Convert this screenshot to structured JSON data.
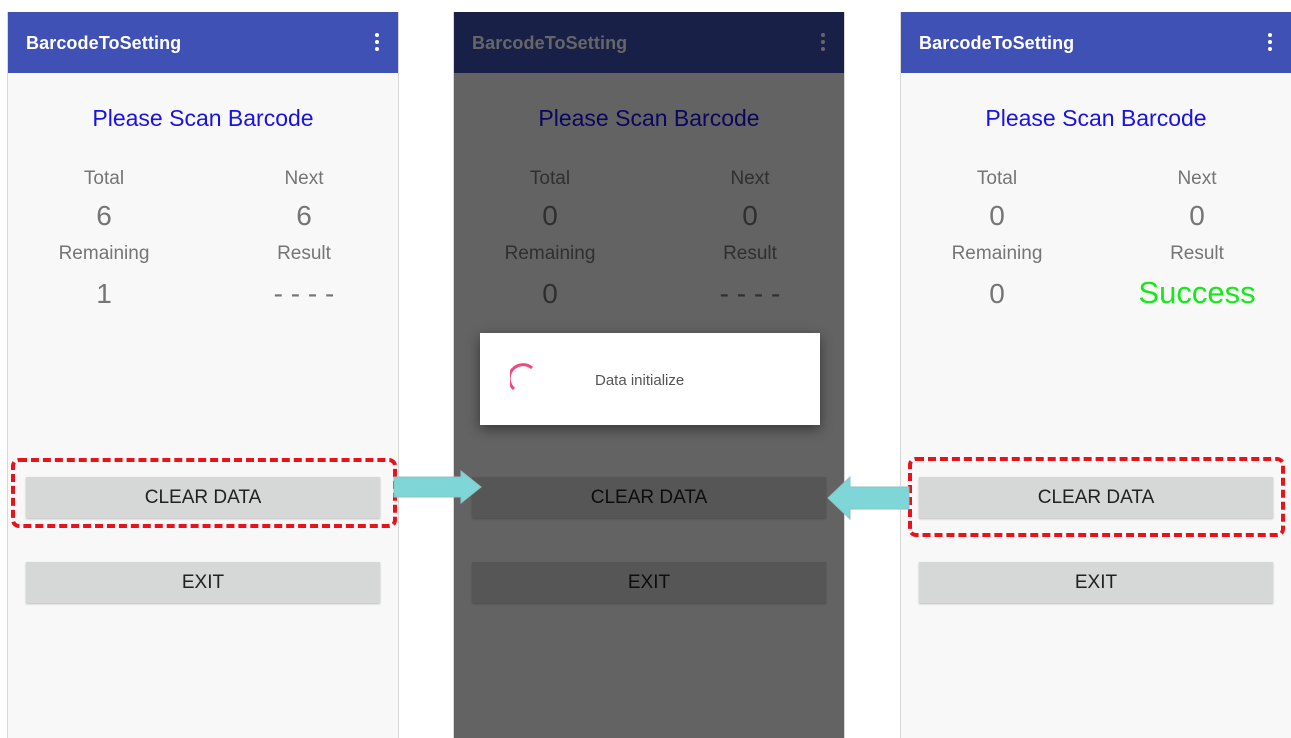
{
  "app_title": "BarcodeToSetting",
  "prompt": "Please Scan Barcode",
  "labels": {
    "total": "Total",
    "next": "Next",
    "remaining": "Remaining",
    "result": "Result"
  },
  "buttons": {
    "clear_data": "CLEAR DATA",
    "exit": "EXIT"
  },
  "icons": {
    "menu": "more-vert-icon",
    "spinner": "progress-spinner-icon",
    "arrow_right": "arrow-right-icon",
    "arrow_left": "arrow-left-icon"
  },
  "colors": {
    "appbar": "#3f51b5",
    "prompt": "#1a10e8",
    "success": "#16e81a",
    "spinner": "#f0487a",
    "highlight": "#e8131a",
    "arrow": "#7ed6d6"
  },
  "screens": {
    "left": {
      "total": "6",
      "next": "6",
      "remaining": "1",
      "result": "- - - -"
    },
    "middle": {
      "total": "0",
      "next": "0",
      "remaining": "0",
      "result": "- - - -",
      "dialog_text": "Data initialize"
    },
    "right": {
      "total": "0",
      "next": "0",
      "remaining": "0",
      "result": "Success"
    }
  }
}
